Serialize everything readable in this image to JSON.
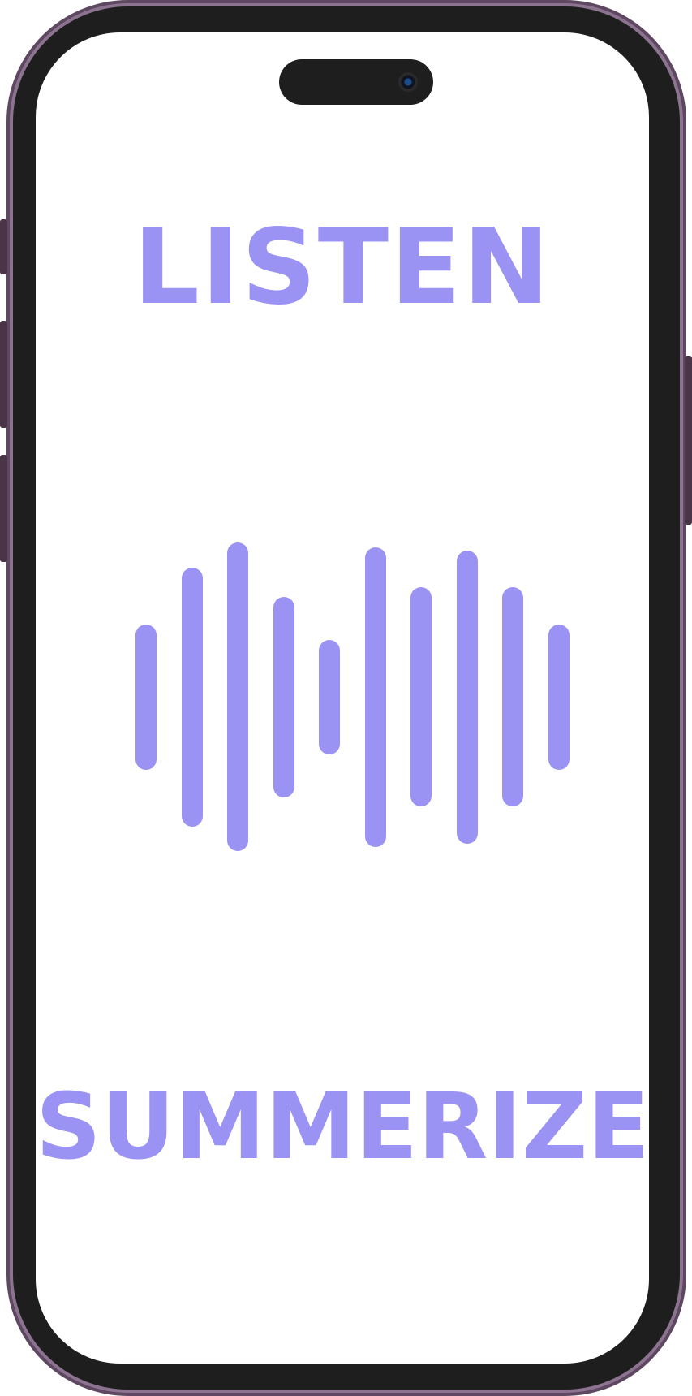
{
  "screen": {
    "headline_top": "LISTEN",
    "headline_bottom": "SUMMERIZE"
  },
  "waveform": {
    "icon": "audio-waveform-icon",
    "bar_count": 10,
    "bar_levels": [
      0.47,
      0.84,
      1.0,
      0.65,
      0.37,
      0.97,
      0.71,
      0.95,
      0.71,
      0.47
    ]
  },
  "colors": {
    "accent": "#9b93f3",
    "frame": "#5e4760",
    "bezel": "#1e1e1e",
    "screen": "#ffffff"
  }
}
